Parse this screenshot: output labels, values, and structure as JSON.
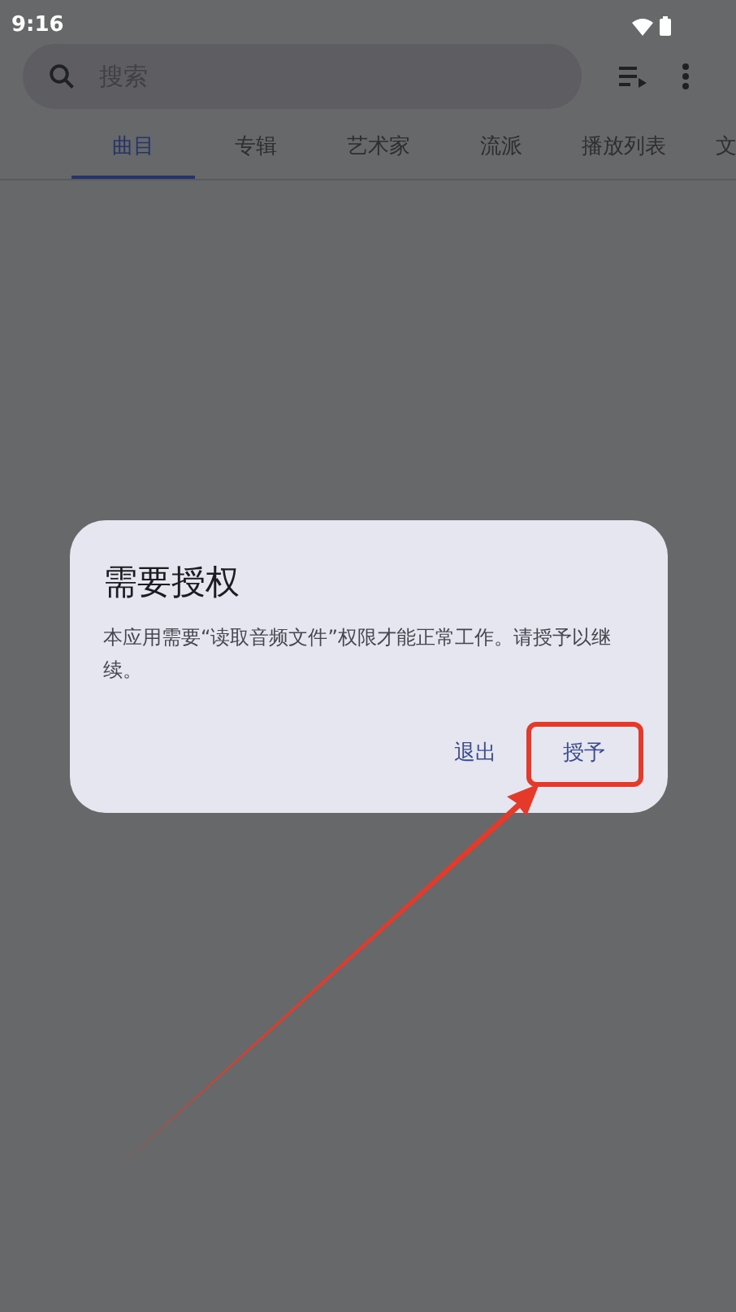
{
  "status_bar": {
    "time": "9:16"
  },
  "search": {
    "placeholder": "搜索"
  },
  "tabs": [
    {
      "label": "曲目",
      "selected": true
    },
    {
      "label": "专辑",
      "selected": false
    },
    {
      "label": "艺术家",
      "selected": false
    },
    {
      "label": "流派",
      "selected": false
    },
    {
      "label": "播放列表",
      "selected": false
    },
    {
      "label": "文",
      "selected": false
    }
  ],
  "dialog": {
    "title": "需要授权",
    "message": "本应用需要“读取音频文件”权限才能正常工作。请授予以继续。",
    "buttons": [
      {
        "label": "退出",
        "highlighted": false
      },
      {
        "label": "授予",
        "highlighted": true
      }
    ]
  }
}
